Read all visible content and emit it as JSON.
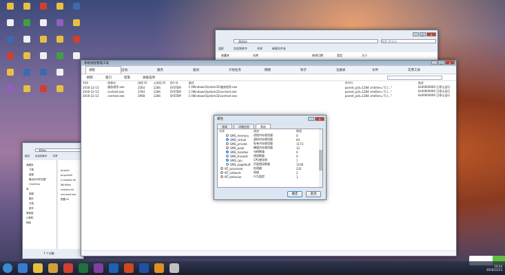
{
  "desktop": {
    "icons": [
      "",
      "",
      "",
      "",
      "",
      "",
      "",
      "",
      "",
      "",
      "",
      "",
      "",
      "",
      "",
      "",
      "",
      "",
      "",
      "",
      "",
      "",
      "",
      "",
      "",
      "",
      "",
      ""
    ],
    "icon_colors": [
      "#e8c040",
      "#f0f0f0",
      "#3a6ab0",
      "#d04030",
      "#e8c040",
      "#9060c0",
      "#e8c040",
      "#40a040",
      "#f0f0f0",
      "#e8c040",
      "#3a6ab0",
      "#e8c040",
      "#d04030",
      "#f0f0f0"
    ]
  },
  "explorer_top": {
    "path": "测试ok",
    "search": "搜索 测试ok",
    "toolbar": [
      "组织",
      "包含到库中",
      "共享",
      "新建文件夹"
    ],
    "nav": [
      "收藏夹",
      "下载"
    ],
    "columns": [
      "名称",
      "修改日期",
      "类型",
      "大小"
    ]
  },
  "main_window": {
    "title": "系统进程管理工具",
    "tabs": [
      "进程",
      "启动",
      "服务",
      "驱动",
      "计划任务",
      "网络",
      "钩子",
      "注册表",
      "文件",
      "实用工具"
    ],
    "toolbar": [
      "刷新",
      "窗口",
      "结束",
      "高级选项"
    ],
    "columns": [
      "时间",
      "映像名",
      "进程 ID",
      "父进程 ID",
      "用户名",
      "路径",
      "命令行",
      "描述"
    ],
    "rows": [
      [
        "2016-12-13",
        "服务程序.exe",
        "2564",
        "1284",
        "SYSTEM",
        "C:\\Windows\\System32\\服务程序.exe",
        "parent_pid=1284 cmdline=\"C:\\...\"",
        "0x00000000 已停止运行"
      ],
      [
        "2016-12-13",
        "svchost.exe",
        "2784",
        "1284",
        "SYSTEM",
        "C:\\Windows\\System32\\svchost.exe",
        "parent_pid=1284 cmdline=\"C:\\...\"",
        "0x00000000 已停止运行"
      ],
      [
        "2016-12-13",
        "conhost.exe",
        "2908",
        "1284",
        "SYSTEM",
        "C:\\Windows\\System32\\conhost.exe",
        "parent_pid=1284 cmdline=\"C:\\...\"",
        "0x00000000 已停止运行"
      ]
    ]
  },
  "dialog": {
    "title": "属性",
    "tabs": [
      "常规",
      "详细信息",
      "筛选"
    ],
    "columns": [
      "名称",
      "描述",
      "数值"
    ],
    "rows": [
      [
        "SMS_memory",
        "进程内存使用量",
        "0"
      ],
      [
        "SMS_virtual",
        "虚拟内存使用量",
        "64"
      ],
      [
        "SMS_private",
        "私有内存使用量",
        "1173"
      ],
      [
        "SMS_peak",
        "峰值内存使用量",
        "12"
      ],
      [
        "SMS_handles",
        "句柄数量",
        "0"
      ],
      [
        "SMS_threads",
        "线程数量",
        "0"
      ],
      [
        "SMS_cpu",
        "CPU使用率",
        "1"
      ],
      [
        "SMS_pagefault",
        "页面错误数量",
        "1100"
      ],
      [
        "NT_processor",
        "处理器",
        "232"
      ],
      [
        "NT_network",
        "网络",
        "2"
      ],
      [
        "NT_behavior",
        "行为监控",
        "1"
      ]
    ],
    "checked": [
      false,
      true,
      false,
      false,
      true,
      false,
      true,
      false,
      false,
      false,
      false
    ],
    "ok": "确定",
    "cancel": "取消"
  },
  "explorer_left": {
    "path": "测试ok",
    "toolbar": [
      "组织",
      "包含到库中",
      "共享"
    ],
    "nav": [
      "收藏夹",
      "下载",
      "桌面",
      "最近访问的位置",
      "OneDrive",
      "库",
      "视频",
      "图片",
      "文档",
      "音乐",
      "家庭组",
      "计算机",
      "网络"
    ],
    "files": [
      "plugins",
      "pluginsdll",
      "x-module.dll",
      "WinMain",
      "readme.txt",
      "uninstall.exe",
      "配置.ini"
    ],
    "status": "7 个对象"
  },
  "taskbar": {
    "apps": [
      "start",
      "ie",
      "explorer",
      "file",
      "chrome",
      "excel",
      "onenote",
      "outlook",
      "powerpoint",
      "word",
      "app1",
      "app2"
    ],
    "app_colors": [
      "#3a8ad0",
      "#3a7ad0",
      "#e8c040",
      "#d0a040",
      "#d04030",
      "#207040",
      "#8040a0",
      "#2060b0",
      "#d04820",
      "#2050a0",
      "#e09020",
      "#c0c0c0"
    ],
    "time": "10:24",
    "date": "2016/12/13"
  },
  "notification": {
    "color": "#60c040"
  }
}
